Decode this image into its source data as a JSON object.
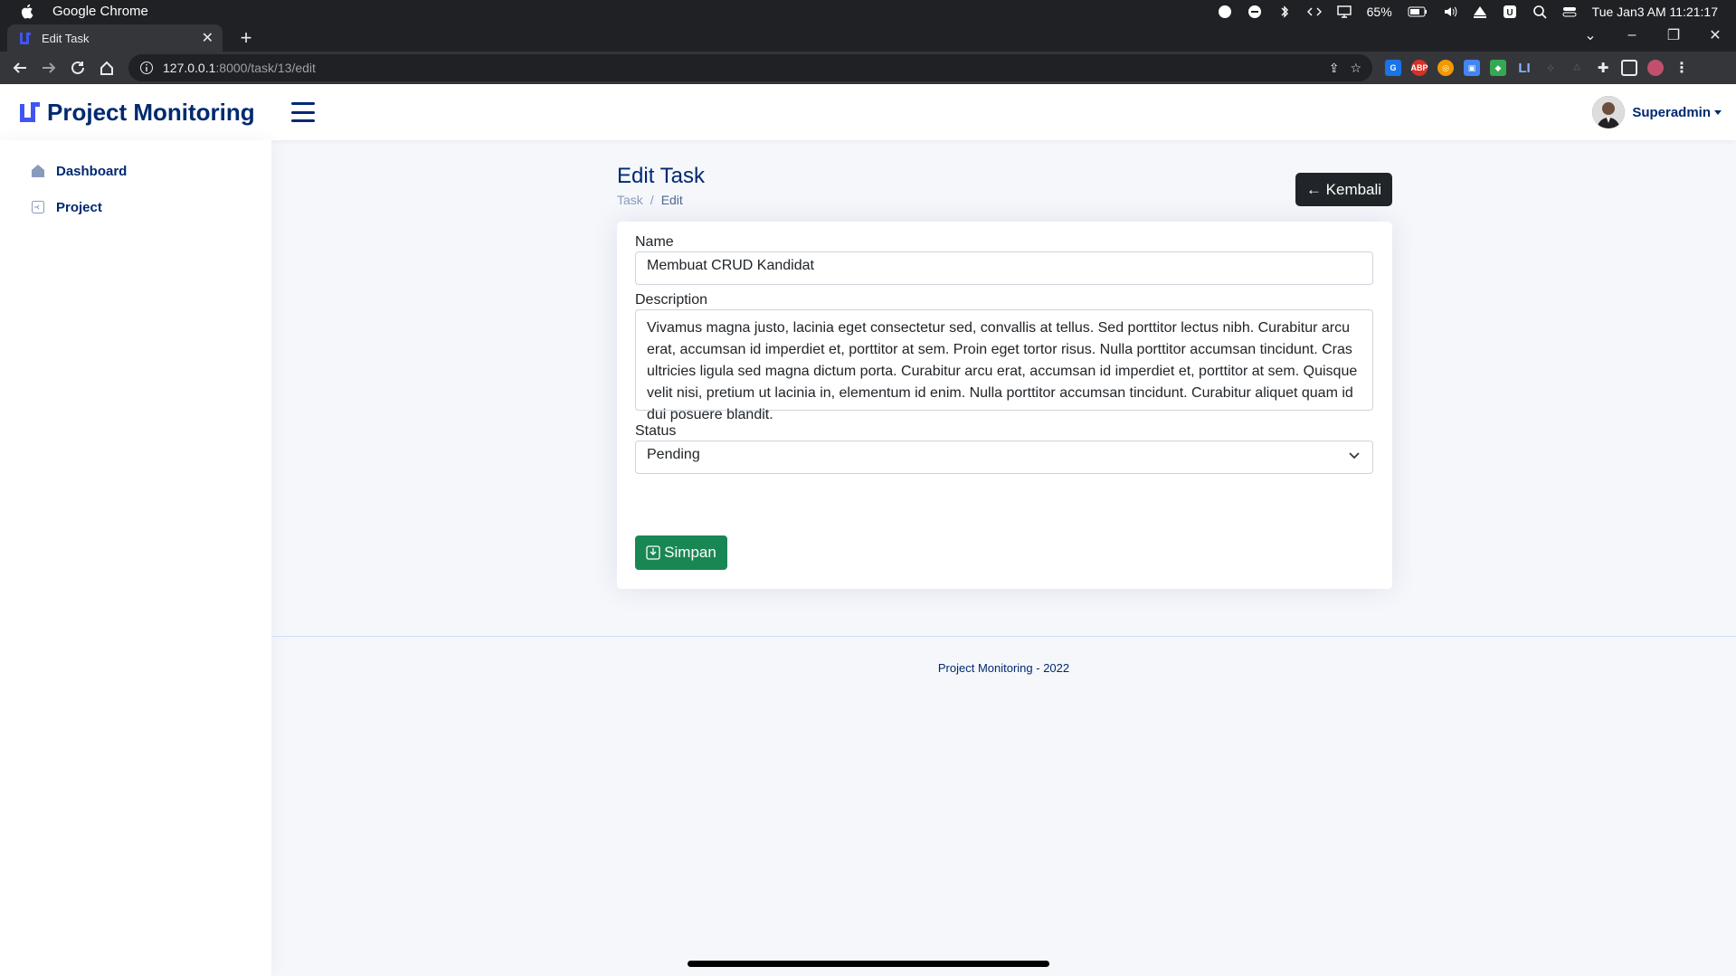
{
  "os": {
    "app_name": "Google Chrome",
    "battery": "65%",
    "datetime": "Tue Jan3 AM 11:21:17"
  },
  "browser": {
    "tab_title": "Edit Task",
    "url_host": "127.0.0.1",
    "url_path": ":8000/task/13/edit"
  },
  "app": {
    "brand": "Project Monitoring",
    "user_name": "Superadmin",
    "sidebar": {
      "items": [
        {
          "label": "Dashboard",
          "icon": "grid-icon"
        },
        {
          "label": "Project",
          "icon": "project-icon"
        }
      ]
    },
    "page": {
      "title": "Edit Task",
      "breadcrumb": [
        "Task",
        "/",
        "Edit"
      ],
      "back_button": "← Kembali"
    },
    "form": {
      "name_label": "Name",
      "name_value": "Membuat CRUD Kandidat",
      "description_label": "Description",
      "description_value": "Vivamus magna justo, lacinia eget consectetur sed, convallis at tellus. Sed porttitor lectus nibh. Curabitur arcu erat, accumsan id imperdiet et, porttitor at sem. Proin eget tortor risus. Nulla porttitor accumsan tincidunt. Cras ultricies ligula sed magna dictum porta. Curabitur arcu erat, accumsan id imperdiet et, porttitor at sem. Quisque velit nisi, pretium ut lacinia in, elementum id enim. Nulla porttitor accumsan tincidunt. Curabitur aliquet quam id dui posuere blandit.",
      "status_label": "Status",
      "status_value": "Pending",
      "save_button": "Simpan"
    },
    "footer": "Project Monitoring - 2022"
  },
  "colors": {
    "brand": "#012970",
    "save": "#198754",
    "back": "#212529",
    "background": "#f5f7fb"
  }
}
